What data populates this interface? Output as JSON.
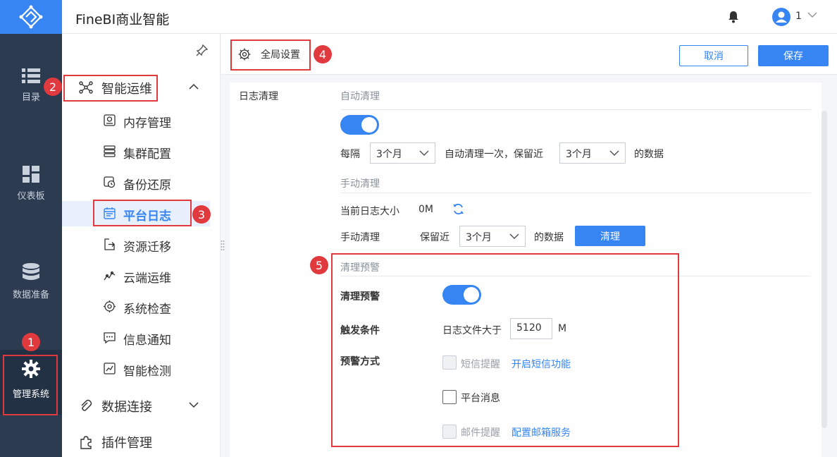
{
  "app": {
    "title": "FineBI商业智能"
  },
  "user": {
    "name": "1"
  },
  "rail": {
    "items": [
      {
        "label": "目录",
        "icon": "list-icon"
      },
      {
        "label": "仪表板",
        "icon": "dashboard-icon"
      },
      {
        "label": "数据准备",
        "icon": "database-icon"
      },
      {
        "label": "管理系统",
        "icon": "gear-icon"
      }
    ]
  },
  "nav": {
    "group_ops": "智能运维",
    "items": [
      {
        "label": "内存管理"
      },
      {
        "label": "集群配置"
      },
      {
        "label": "备份还原"
      },
      {
        "label": "平台日志"
      },
      {
        "label": "资源迁移"
      },
      {
        "label": "云端运维"
      },
      {
        "label": "系统检查"
      },
      {
        "label": "信息通知"
      },
      {
        "label": "智能检测"
      }
    ],
    "group_data": "数据连接",
    "group_plugin": "插件管理"
  },
  "toolbar": {
    "tab_label": "全局设置",
    "cancel_label": "取消",
    "save_label": "保存"
  },
  "content": {
    "section_label": "日志清理",
    "auto": {
      "title": "自动清理",
      "enabled": true,
      "every_label": "每隔",
      "interval": "3个月",
      "mid_label": "自动清理一次，保留近",
      "keep": "3个月",
      "suffix": "的数据"
    },
    "manual": {
      "title": "手动清理",
      "size_label": "当前日志大小",
      "size_value": "0M",
      "clean_label": "手动清理",
      "keep_label": "保留近",
      "keep": "3个月",
      "suffix": "的数据",
      "clean_button": "清理"
    },
    "warning": {
      "title": "清理预警",
      "enable_label": "清理预警",
      "enabled": true,
      "trigger_label": "触发条件",
      "trigger_text": "日志文件大于",
      "trigger_value": "5120",
      "trigger_unit": "M",
      "method_label": "预警方式",
      "sms_label": "短信提醒",
      "sms_link": "开启短信功能",
      "platform_label": "平台消息",
      "email_label": "邮件提醒",
      "email_link": "配置邮箱服务"
    }
  },
  "annotations": [
    "1",
    "2",
    "3",
    "4",
    "5"
  ],
  "colors": {
    "accent": "#3685f2",
    "rail": "#2c3b50",
    "annotation": "#e0393e"
  }
}
